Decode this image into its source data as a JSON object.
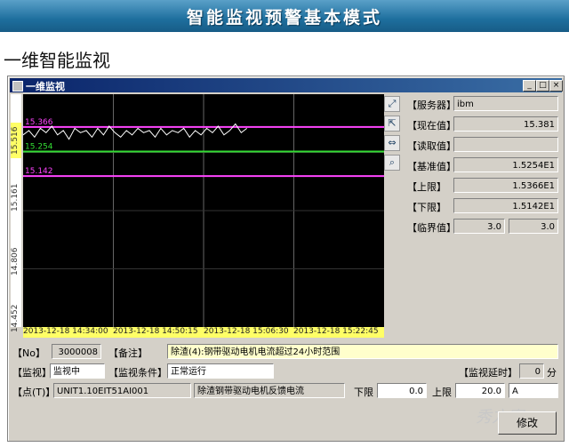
{
  "banner": {
    "title": "智能监视预警基本模式"
  },
  "section": {
    "title": "一维智能监视"
  },
  "window": {
    "title": "一维监视",
    "btn_min": "_",
    "btn_max": "□",
    "btn_close": "×"
  },
  "side": {
    "server_label": "【服务器】",
    "server_value": "ibm",
    "current_label": "【现在值】",
    "current_value": "15.381",
    "read_label": "【读取值】",
    "read_value": "",
    "base_label": "【基准值】",
    "base_value": "1.5254E1",
    "upper_label": "【上限】",
    "upper_value": "1.5366E1",
    "lower_label": "【下限】",
    "lower_value": "1.5142E1",
    "critical_label": "【临界值】",
    "critical_value_1": "3.0",
    "critical_value_2": "3.0"
  },
  "bottom": {
    "no_label": "【No】",
    "no_value": "3000008",
    "remark_label": "【备注】",
    "remark_value": "除渣(4):钢带驱动电机电流超过24小时范围",
    "monitor_label": "【监视】",
    "monitor_value": "监视中",
    "cond_label": "【监视条件】",
    "cond_value": "正常运行",
    "delay_label": "【监视延时】",
    "delay_value": "0",
    "delay_unit": "分",
    "point_label": "【点(T)】",
    "point_value": "UNIT1.10EIT51AI001",
    "point_desc": "除渣钢带驱动电机反馈电流",
    "low_label": "下限",
    "low_value": "0.0",
    "high_label": "上限",
    "high_value": "20.0",
    "unit_value": "A",
    "modify_label": "修改"
  },
  "watermark": "秀方案",
  "chart_data": {
    "type": "line",
    "yticks": [
      "15.516",
      "15.161",
      "14.806",
      "14.452"
    ],
    "ylim": [
      14.452,
      15.516
    ],
    "xticks": [
      "2013-12-18 14:34:00",
      "2013-12-18 14:50:15",
      "2013-12-18 15:06:30",
      "2013-12-18 15:22:45"
    ],
    "reference_lines": [
      {
        "label": "15.366",
        "value": 15.366,
        "color": "#ff44ff"
      },
      {
        "label": "15.254",
        "value": 15.254,
        "color": "#33dd33"
      },
      {
        "label": "15.142",
        "value": 15.142,
        "color": "#ff44ff"
      }
    ],
    "series": [
      {
        "color": "#ffffff",
        "values": [
          15.33,
          15.35,
          15.32,
          15.36,
          15.34,
          15.37,
          15.33,
          15.35,
          15.31,
          15.36,
          15.34,
          15.35,
          15.32,
          15.36,
          15.33,
          15.37,
          15.34,
          15.32,
          15.35,
          15.33,
          15.36,
          15.34,
          15.35,
          15.32,
          15.36,
          15.33,
          15.35,
          15.34,
          15.36,
          15.32,
          15.35,
          15.33,
          15.36,
          15.34,
          15.37,
          15.33,
          15.35,
          15.38,
          15.34,
          15.36
        ]
      }
    ],
    "series_x_fraction_end": 0.62
  }
}
